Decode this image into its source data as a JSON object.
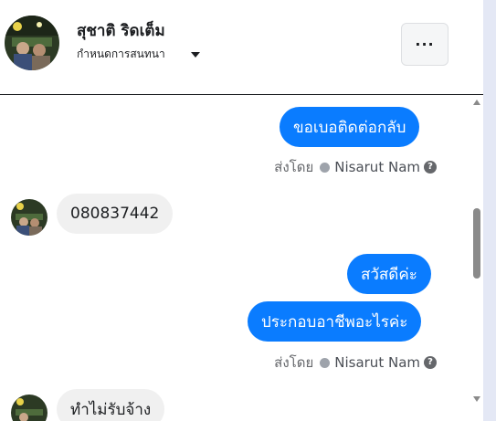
{
  "header": {
    "name": "สุชาติ ริดเต็ม",
    "subtitle": "กำหนดการสนทนา",
    "more_label": "···"
  },
  "messages": [
    {
      "direction": "out",
      "text": "ขอเบอติดต่อกลับ"
    },
    {
      "direction": "meta",
      "prefix": "ส่งโดย",
      "author": "Nisarut Nam",
      "help": "?"
    },
    {
      "direction": "in",
      "text": "080837442"
    },
    {
      "direction": "out",
      "text": "สวัสดีค่ะ"
    },
    {
      "direction": "out",
      "text": "ประกอบอาชีพอะไรค่ะ"
    },
    {
      "direction": "meta",
      "prefix": "ส่งโดย",
      "author": "Nisarut Nam",
      "help": "?"
    },
    {
      "direction": "in",
      "text": "ทำไม่รับจ้าง"
    }
  ],
  "colors": {
    "outgoing_bubble": "#0a7cff",
    "incoming_bubble": "#f0f0f0",
    "text": "#1c1e21",
    "meta_text": "#65676b"
  }
}
